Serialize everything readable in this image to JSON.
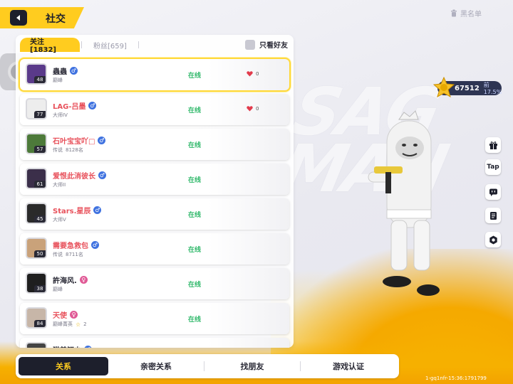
{
  "header": {
    "title": "社交",
    "blacklist_label": "黑名单"
  },
  "tabs": [
    {
      "label": "关注[1832]",
      "active": true
    },
    {
      "label": "粉丝[659]",
      "active": false
    }
  ],
  "filter": {
    "label": "只看好友"
  },
  "friends": [
    {
      "name": "蟲蟲",
      "name_color": "dark",
      "gender": "m",
      "level": "48",
      "rank": "巅峰",
      "extra": "",
      "status": "在线",
      "likes": "0",
      "show_likes": true,
      "avatar_color": "#5a3a8a",
      "selected": true
    },
    {
      "name": "LAG-吕墨",
      "name_color": "red",
      "gender": "m",
      "level": "77",
      "rank": "大师IV",
      "extra": "",
      "status": "在线",
      "likes": "0",
      "show_likes": true,
      "avatar_color": "#ededed",
      "selected": false
    },
    {
      "name": "石叶宝宝吖□",
      "name_color": "red",
      "gender": "m",
      "level": "57",
      "rank": "传说",
      "extra": "8128名",
      "status": "在线",
      "likes": "",
      "show_likes": false,
      "avatar_color": "#4d7a3a",
      "selected": false
    },
    {
      "name": "爱恨此消彼长",
      "name_color": "red",
      "gender": "m",
      "level": "61",
      "rank": "大师II",
      "extra": "",
      "status": "在线",
      "likes": "",
      "show_likes": false,
      "avatar_color": "#3b2f4a",
      "selected": false
    },
    {
      "name": "Stars.星辰",
      "name_color": "red",
      "gender": "m",
      "level": "45",
      "rank": "大师V",
      "extra": "",
      "status": "在线",
      "likes": "",
      "show_likes": false,
      "avatar_color": "#2a2a2a",
      "selected": false
    },
    {
      "name": "需要急救包",
      "name_color": "red",
      "gender": "m",
      "level": "50",
      "rank": "传说",
      "extra": "8711名",
      "status": "在线",
      "likes": "",
      "show_likes": false,
      "avatar_color": "#c9a27a",
      "selected": false
    },
    {
      "name": "許海风.",
      "name_color": "dark",
      "gender": "f",
      "level": "38",
      "rank": "巅峰",
      "extra": "",
      "status": "在线",
      "likes": "",
      "show_likes": false,
      "avatar_color": "#1f1f1f",
      "selected": false
    },
    {
      "name": "天使",
      "name_color": "red",
      "gender": "f",
      "level": "84",
      "rank": "巅峰菁英",
      "extra": "2",
      "status": "在线",
      "likes": "",
      "show_likes": false,
      "avatar_color": "#c7b6a8",
      "selected": false
    },
    {
      "name": "猫美钰少",
      "name_color": "dark",
      "gender": "m",
      "level": "",
      "rank": "",
      "extra": "",
      "status": "",
      "likes": "",
      "show_likes": false,
      "avatar_color": "#444444",
      "selected": false
    }
  ],
  "coins": {
    "value": "67512",
    "percent": "前17.5%"
  },
  "side_icons": [
    {
      "name": "gift-icon",
      "label": ""
    },
    {
      "name": "taptap-icon",
      "label": "Tap"
    },
    {
      "name": "chat-icon",
      "label": ""
    },
    {
      "name": "note-icon",
      "label": ""
    },
    {
      "name": "settings-icon",
      "label": ""
    }
  ],
  "bottom_nav": [
    {
      "label": "关系",
      "active": true
    },
    {
      "label": "亲密关系",
      "active": false
    },
    {
      "label": "找朋友",
      "active": false
    },
    {
      "label": "游戏认证",
      "active": false
    }
  ],
  "footer": {
    "build_id": "1-gq1nfr-15:36:1791799"
  },
  "background": {
    "watermark": "SAG MAN"
  },
  "colors": {
    "accent": "#ffcc1f",
    "dark": "#1d1f2c",
    "online": "#2fb86a",
    "name_red": "#e8525c",
    "male": "#3f72e0",
    "female": "#e05a96"
  }
}
